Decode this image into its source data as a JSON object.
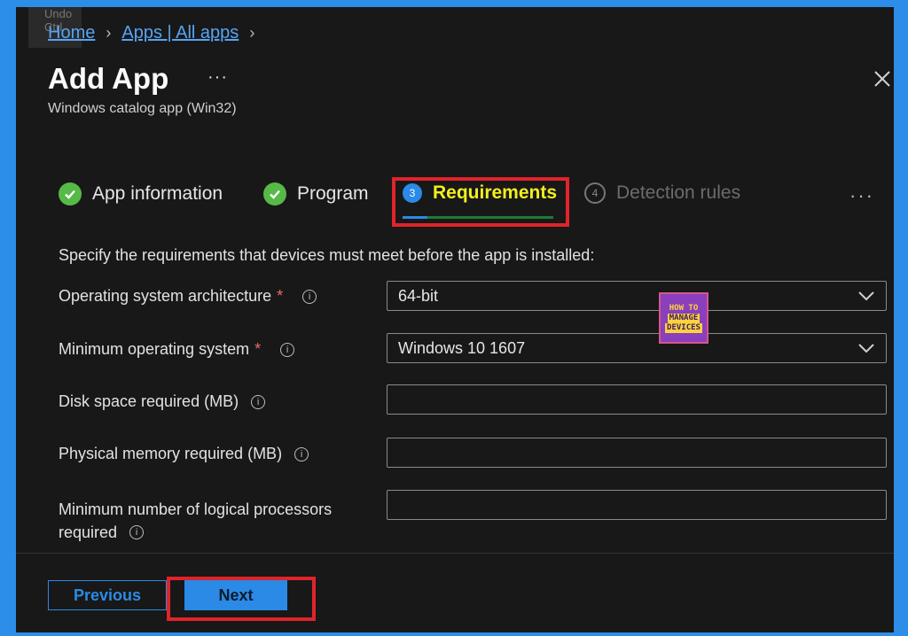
{
  "tooltip": {
    "line1": "Undo",
    "line2": "Ctrl"
  },
  "breadcrumb": {
    "home": "Home",
    "apps": "Apps | All apps"
  },
  "header": {
    "title": "Add App",
    "more": "···",
    "subtitle": "Windows catalog app (Win32)"
  },
  "steps": [
    {
      "label": "App information",
      "status": "complete"
    },
    {
      "label": "Program",
      "status": "complete"
    },
    {
      "number": "3",
      "label": "Requirements",
      "status": "active"
    },
    {
      "number": "4",
      "label": "Detection rules",
      "status": "inactive"
    }
  ],
  "steps_more": "···",
  "instruction": "Specify the requirements that devices must meet before the app is installed:",
  "fields": {
    "os_arch": {
      "label": "Operating system architecture",
      "required": "*",
      "value": "64-bit"
    },
    "min_os": {
      "label": "Minimum operating system",
      "required": "*",
      "value": "Windows 10 1607"
    },
    "disk": {
      "label": "Disk space required (MB)",
      "value": ""
    },
    "memory": {
      "label": "Physical memory required (MB)",
      "value": ""
    },
    "cpu": {
      "label_line1": "Minimum number of logical processors",
      "label_line2": "required",
      "value": ""
    }
  },
  "logo": {
    "line1": "HOW TO",
    "line2": "MANAGE",
    "line3": "DEVICES"
  },
  "footer": {
    "previous": "Previous",
    "next": "Next"
  },
  "colors": {
    "accent": "#2a8ae6",
    "highlight_border": "#e0242a",
    "active_step_text": "#f2ef1f",
    "complete_check": "#57b947",
    "page_border": "#2d8ee9"
  }
}
